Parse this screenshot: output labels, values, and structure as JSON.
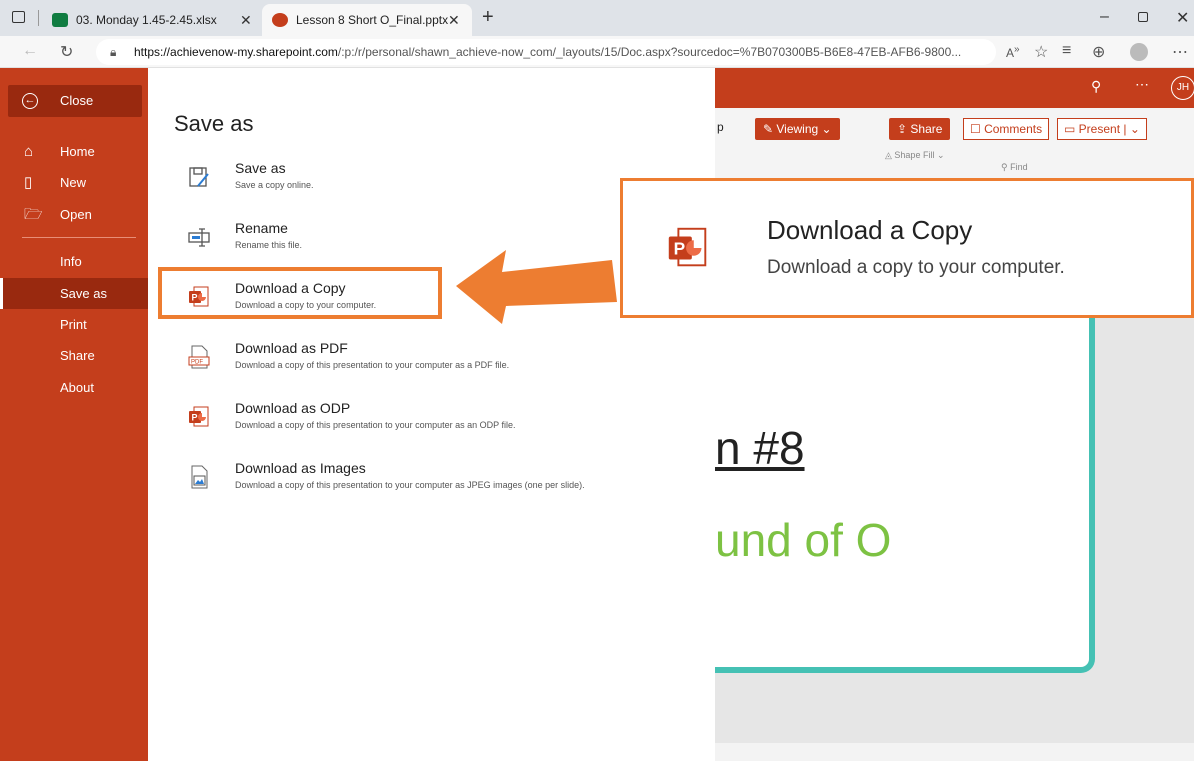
{
  "browser": {
    "tabs": [
      {
        "label": "03. Monday 1.45-2.45.xlsx",
        "icon": "excel-icon",
        "color": "#107c41"
      },
      {
        "label": "Lesson 8 Short O_Final.pptx",
        "icon": "powerpoint-icon",
        "color": "#c43e1c"
      }
    ],
    "url_host": "https://achievenow-my.sharepoint.com",
    "url_path": "/:p:/r/personal/shawn_achieve-now_com/_layouts/15/Doc.aspx?sourcedoc=%7B070300B5-B6E8-47EB-AFB6-9800..."
  },
  "backstage": {
    "close_label": "Close",
    "nav": [
      {
        "label": "Home",
        "icon": "home-icon"
      },
      {
        "label": "New",
        "icon": "new-file-icon"
      },
      {
        "label": "Open",
        "icon": "folder-icon"
      },
      {
        "label": "Info",
        "icon": ""
      },
      {
        "label": "Save as",
        "icon": "",
        "selected": true
      },
      {
        "label": "Print",
        "icon": ""
      },
      {
        "label": "Share",
        "icon": ""
      },
      {
        "label": "About",
        "icon": ""
      }
    ],
    "title": "Save as",
    "options": [
      {
        "title": "Save as",
        "desc": "Save a copy online.",
        "icon": "save-as-icon"
      },
      {
        "title": "Rename",
        "desc": "Rename this file.",
        "icon": "rename-icon"
      },
      {
        "title": "Download a Copy",
        "desc": "Download a copy to your computer.",
        "icon": "powerpoint-file-icon"
      },
      {
        "title": "Download as PDF",
        "desc": "Download a copy of this presentation to your computer as a PDF file.",
        "icon": "pdf-file-icon"
      },
      {
        "title": "Download as ODP",
        "desc": "Download a copy of this presentation to your computer as an ODP file.",
        "icon": "odp-file-icon"
      },
      {
        "title": "Download as Images",
        "desc": "Download a copy of this presentation to your computer as JPEG images (one per slide).",
        "icon": "image-file-icon"
      }
    ]
  },
  "app": {
    "avatar": "JH",
    "viewing_label": "Viewing",
    "share_label": "Share",
    "comments_label": "Comments",
    "present_label": "Present",
    "shape_fill_label": "Shape Fill",
    "find_label": "Find",
    "slide_title": "n #8",
    "slide_subtitle": "und of O",
    "accent": "#c43e1c"
  },
  "callout": {
    "title": "Download a Copy",
    "desc": "Download a copy to your computer.",
    "color": "#ed7d31"
  }
}
